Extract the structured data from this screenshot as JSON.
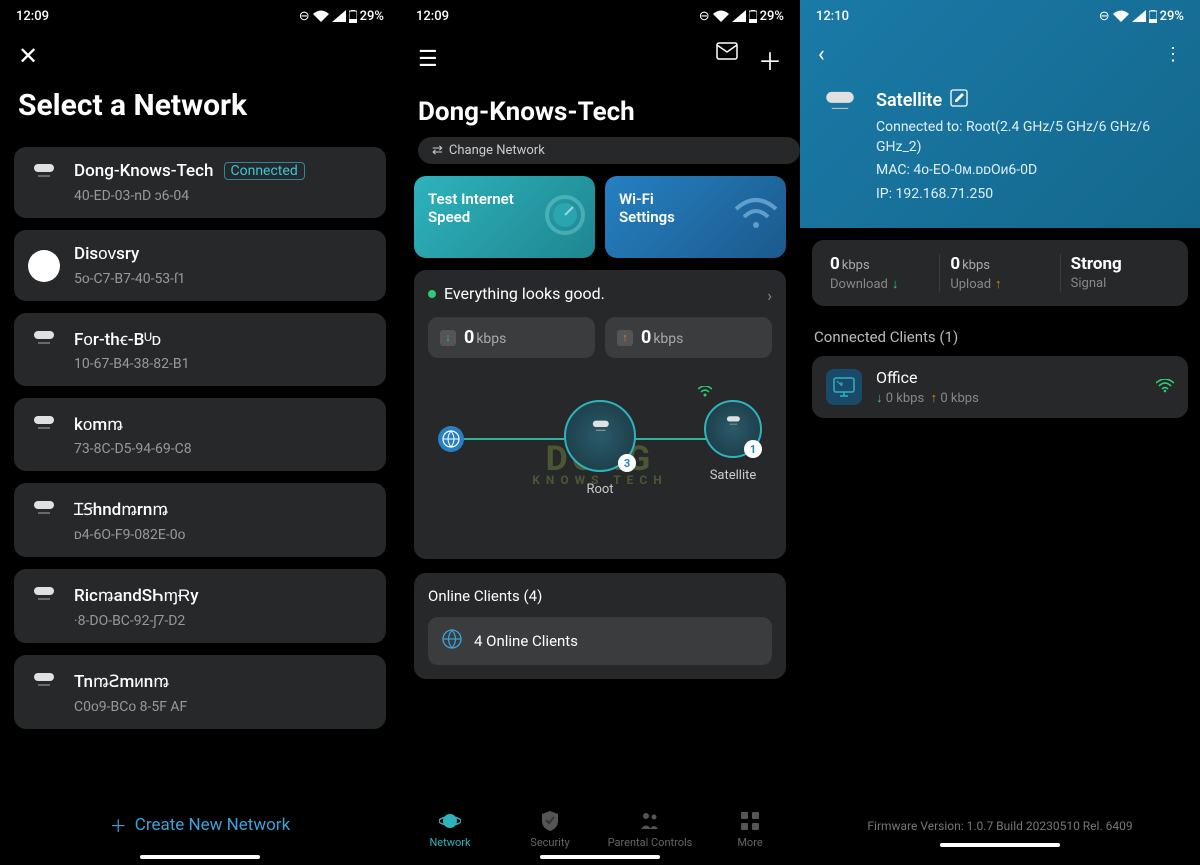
{
  "status_bar": {
    "time1": "12:09",
    "time2": "12:09",
    "time3": "12:10",
    "battery": "29%"
  },
  "phone1": {
    "title": "Select a Network",
    "networks": [
      {
        "name": "Dong-Knows-Tech",
        "mac": "40-ED-03-nD ɔ6-04",
        "connected": true,
        "badge": "Connected",
        "type": "tower"
      },
      {
        "name": "Disᴏᴠsry",
        "mac": "5ᴏ-C7-B7-40-53-ſ1",
        "type": "disc"
      },
      {
        "name": "Fᴏr-thꞓ-Bᵁᴅ",
        "mac": "10-67-B4-38-82-B1",
        "type": "tower"
      },
      {
        "name": "kᴏmꬺ",
        "mac": "73-8C-D5-94-69-C8",
        "type": "tower"
      },
      {
        "name": "ꞮꞨhndꬺrnꬺ",
        "mac": "ᴅ4-6O-F9-082E-0ᴏ",
        "type": "tower"
      },
      {
        "name": "RicꬺandSҺɱɌy",
        "mac": "·8-DO-BC-92-ʃ7-D2",
        "type": "tower"
      },
      {
        "name": "TnꬺꙄmᴎnꬺ",
        "mac": "C0ᴏ9-BCᴏ 8-5F AF",
        "type": "tower"
      }
    ],
    "create": "Create New Network"
  },
  "phone2": {
    "title": "Dong-Knows-Tech",
    "change_network": "Change Network",
    "btn_speed": "Test Internet Speed",
    "btn_wifi": "Wi-Fi Settings",
    "status_text": "Everything looks good.",
    "dl_val": "0",
    "dl_unit": "kbps",
    "ul_val": "0",
    "ul_unit": "kbps",
    "root_label": "Root",
    "root_badge": "3",
    "sat_label": "Satellite",
    "sat_badge": "1",
    "clients_title": "Online Clients (4)",
    "clients_row": "4 Online Clients",
    "nav": [
      "Network",
      "Security",
      "Parental Controls",
      "More"
    ],
    "watermark": "DONG",
    "watermark_sub": "KNOWS TECH"
  },
  "phone3": {
    "name": "Satellite",
    "connected_to": "Connected to: Root(2.4 GHz/5 GHz/6 GHz/6 GHz_2)",
    "mac": "MAC: 4ᴏ-EO-0ᴍ.ᴅᴅOᴎ6-0D",
    "ip": "IP: 192.168.71.250",
    "dl_val": "0",
    "dl_unit": "kbps",
    "dl_label": "Download",
    "ul_val": "0",
    "ul_unit": "kbps",
    "ul_label": "Upload",
    "signal_val": "Strong",
    "signal_label": "Signal",
    "clients_header": "Connected Clients (1)",
    "client_name": "Office",
    "client_speed_dl": "0 kbps",
    "client_speed_ul": "0 kbps",
    "firmware": "Firmware Version: 1.0.7 Build 20230510 Rel. 6409"
  }
}
